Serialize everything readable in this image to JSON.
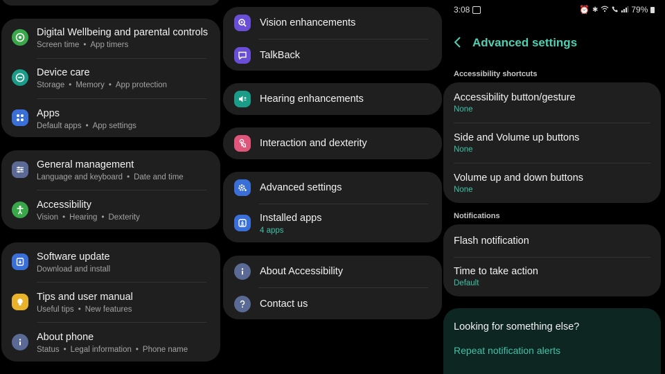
{
  "col1": {
    "items": [
      {
        "title": "Digital Wellbeing and parental controls",
        "subs": [
          "Screen time",
          "App timers"
        ]
      },
      {
        "title": "Device care",
        "subs": [
          "Storage",
          "Memory",
          "App protection"
        ]
      },
      {
        "title": "Apps",
        "subs": [
          "Default apps",
          "App settings"
        ]
      },
      {
        "title": "General management",
        "subs": [
          "Language and keyboard",
          "Date and time"
        ]
      },
      {
        "title": "Accessibility",
        "subs": [
          "Vision",
          "Hearing",
          "Dexterity"
        ]
      },
      {
        "title": "Software update",
        "subs": [
          "Download and install"
        ]
      },
      {
        "title": "Tips and user manual",
        "subs": [
          "Useful tips",
          "New features"
        ]
      },
      {
        "title": "About phone",
        "subs": [
          "Status",
          "Legal information",
          "Phone name"
        ]
      }
    ]
  },
  "col2": {
    "items": [
      {
        "title": "Vision enhancements"
      },
      {
        "title": "TalkBack"
      },
      {
        "title": "Hearing enhancements"
      },
      {
        "title": "Interaction and dexterity"
      },
      {
        "title": "Advanced settings"
      },
      {
        "title": "Installed apps",
        "sub": "4 apps"
      },
      {
        "title": "About Accessibility"
      },
      {
        "title": "Contact us"
      }
    ]
  },
  "status": {
    "time": "3:08",
    "battery": "79%"
  },
  "advanced": {
    "title": "Advanced settings",
    "section_shortcuts": "Accessibility shortcuts",
    "shortcuts": [
      {
        "title": "Accessibility button/gesture",
        "value": "None"
      },
      {
        "title": "Side and Volume up buttons",
        "value": "None"
      },
      {
        "title": "Volume up and down buttons",
        "value": "None"
      }
    ],
    "section_notifications": "Notifications",
    "notifications": [
      {
        "title": "Flash notification"
      },
      {
        "title": "Time to take action",
        "value": "Default"
      }
    ],
    "looking_title": "Looking for something else?",
    "looking_link": "Repeat notification alerts"
  },
  "colors": {
    "accent": "#3fc2a8",
    "card": "#1f1f1f",
    "green": "#3aa84a",
    "teal": "#1b9c88",
    "blue": "#3a6fd8",
    "slate": "#5a6a94",
    "yellow": "#e8b22c",
    "purple": "#6a4fd6",
    "pink": "#e0567a"
  }
}
